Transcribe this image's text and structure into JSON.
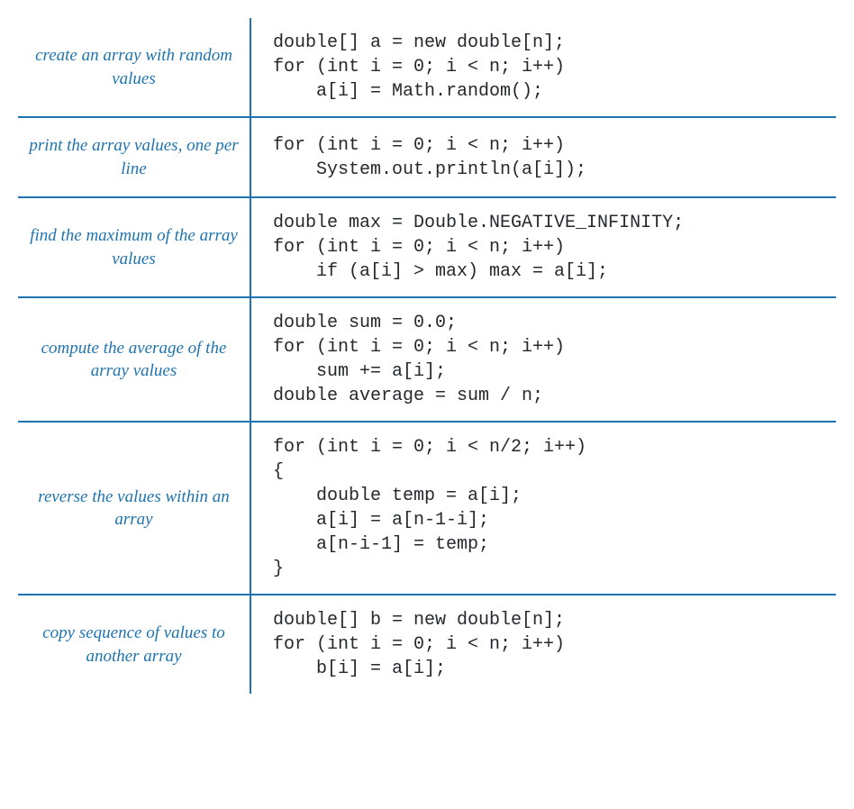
{
  "rows": [
    {
      "label": "create an array\nwith random values",
      "code": "double[] a = new double[n];\nfor (int i = 0; i < n; i++)\n    a[i] = Math.random();"
    },
    {
      "label": "print the array values,\none per line",
      "code": "for (int i = 0; i < n; i++)\n    System.out.println(a[i]);"
    },
    {
      "label": "find the maximum of\nthe array values",
      "code": "double max = Double.NEGATIVE_INFINITY;\nfor (int i = 0; i < n; i++)\n    if (a[i] > max) max = a[i];"
    },
    {
      "label": "compute the average of\nthe array values",
      "code": "double sum = 0.0;\nfor (int i = 0; i < n; i++)\n    sum += a[i];\ndouble average = sum / n;"
    },
    {
      "label": "reverse the values\nwithin an array",
      "code": "for (int i = 0; i < n/2; i++)\n{\n    double temp = a[i];\n    a[i] = a[n-1-i];\n    a[n-i-1] = temp;\n}"
    },
    {
      "label": "copy sequence of values\nto another array",
      "code": "double[] b = new double[n];\nfor (int i = 0; i < n; i++)\n    b[i] = a[i];"
    }
  ]
}
